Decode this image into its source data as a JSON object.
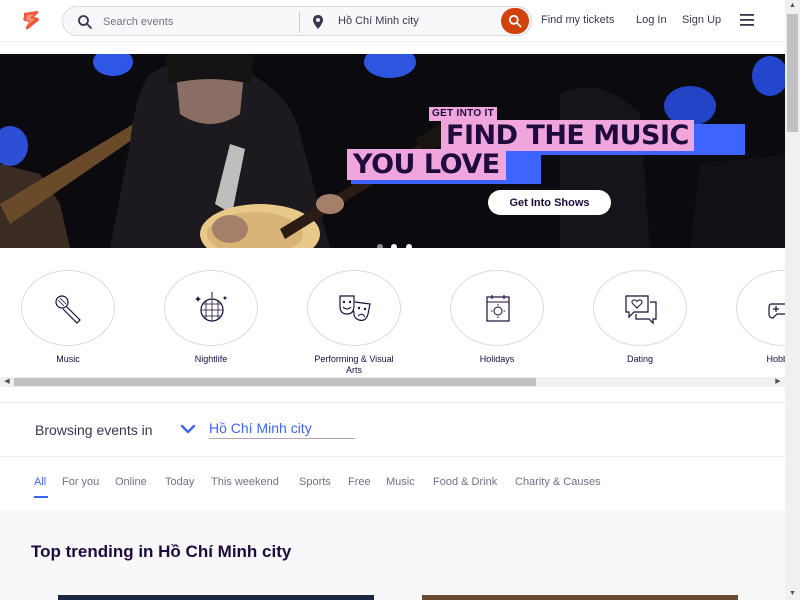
{
  "header": {
    "logo_icon": "eventbrite-logo-icon",
    "search_placeholder": "Search events",
    "location": "Hồ Chí Minh city",
    "nav": [
      "Find my tickets",
      "Log In",
      "Sign Up"
    ],
    "accent": "#d1410c"
  },
  "hero": {
    "tag": "GET INTO IT",
    "line1": "FIND THE MUSIC",
    "line2": "YOU LOVE",
    "button": "Get Into Shows",
    "slides": 3,
    "active_slide": 2
  },
  "categories": [
    {
      "label": "Music",
      "icon": "microphone-icon"
    },
    {
      "label": "Nightlife",
      "icon": "disco-ball-icon"
    },
    {
      "label": "Performing & Visual Arts",
      "icon": "theater-masks-icon"
    },
    {
      "label": "Holidays",
      "icon": "calendar-sun-icon"
    },
    {
      "label": "Dating",
      "icon": "chat-heart-icon"
    },
    {
      "label": "Hobbies",
      "icon": "gamepad-icon"
    }
  ],
  "browse": {
    "label": "Browsing events in",
    "city": "Hồ Chí Minh city"
  },
  "tabs": [
    "All",
    "For you",
    "Online",
    "Today",
    "This weekend",
    "Sports",
    "Free",
    "Music",
    "Food & Drink",
    "Charity & Causes"
  ],
  "active_tab": "All",
  "trending": {
    "title": "Top trending in Hồ Chí Minh city"
  },
  "colors": {
    "link_blue": "#3d64ff",
    "hero_pink": "#f0a6dd",
    "text_dark": "#1e0a3c"
  }
}
